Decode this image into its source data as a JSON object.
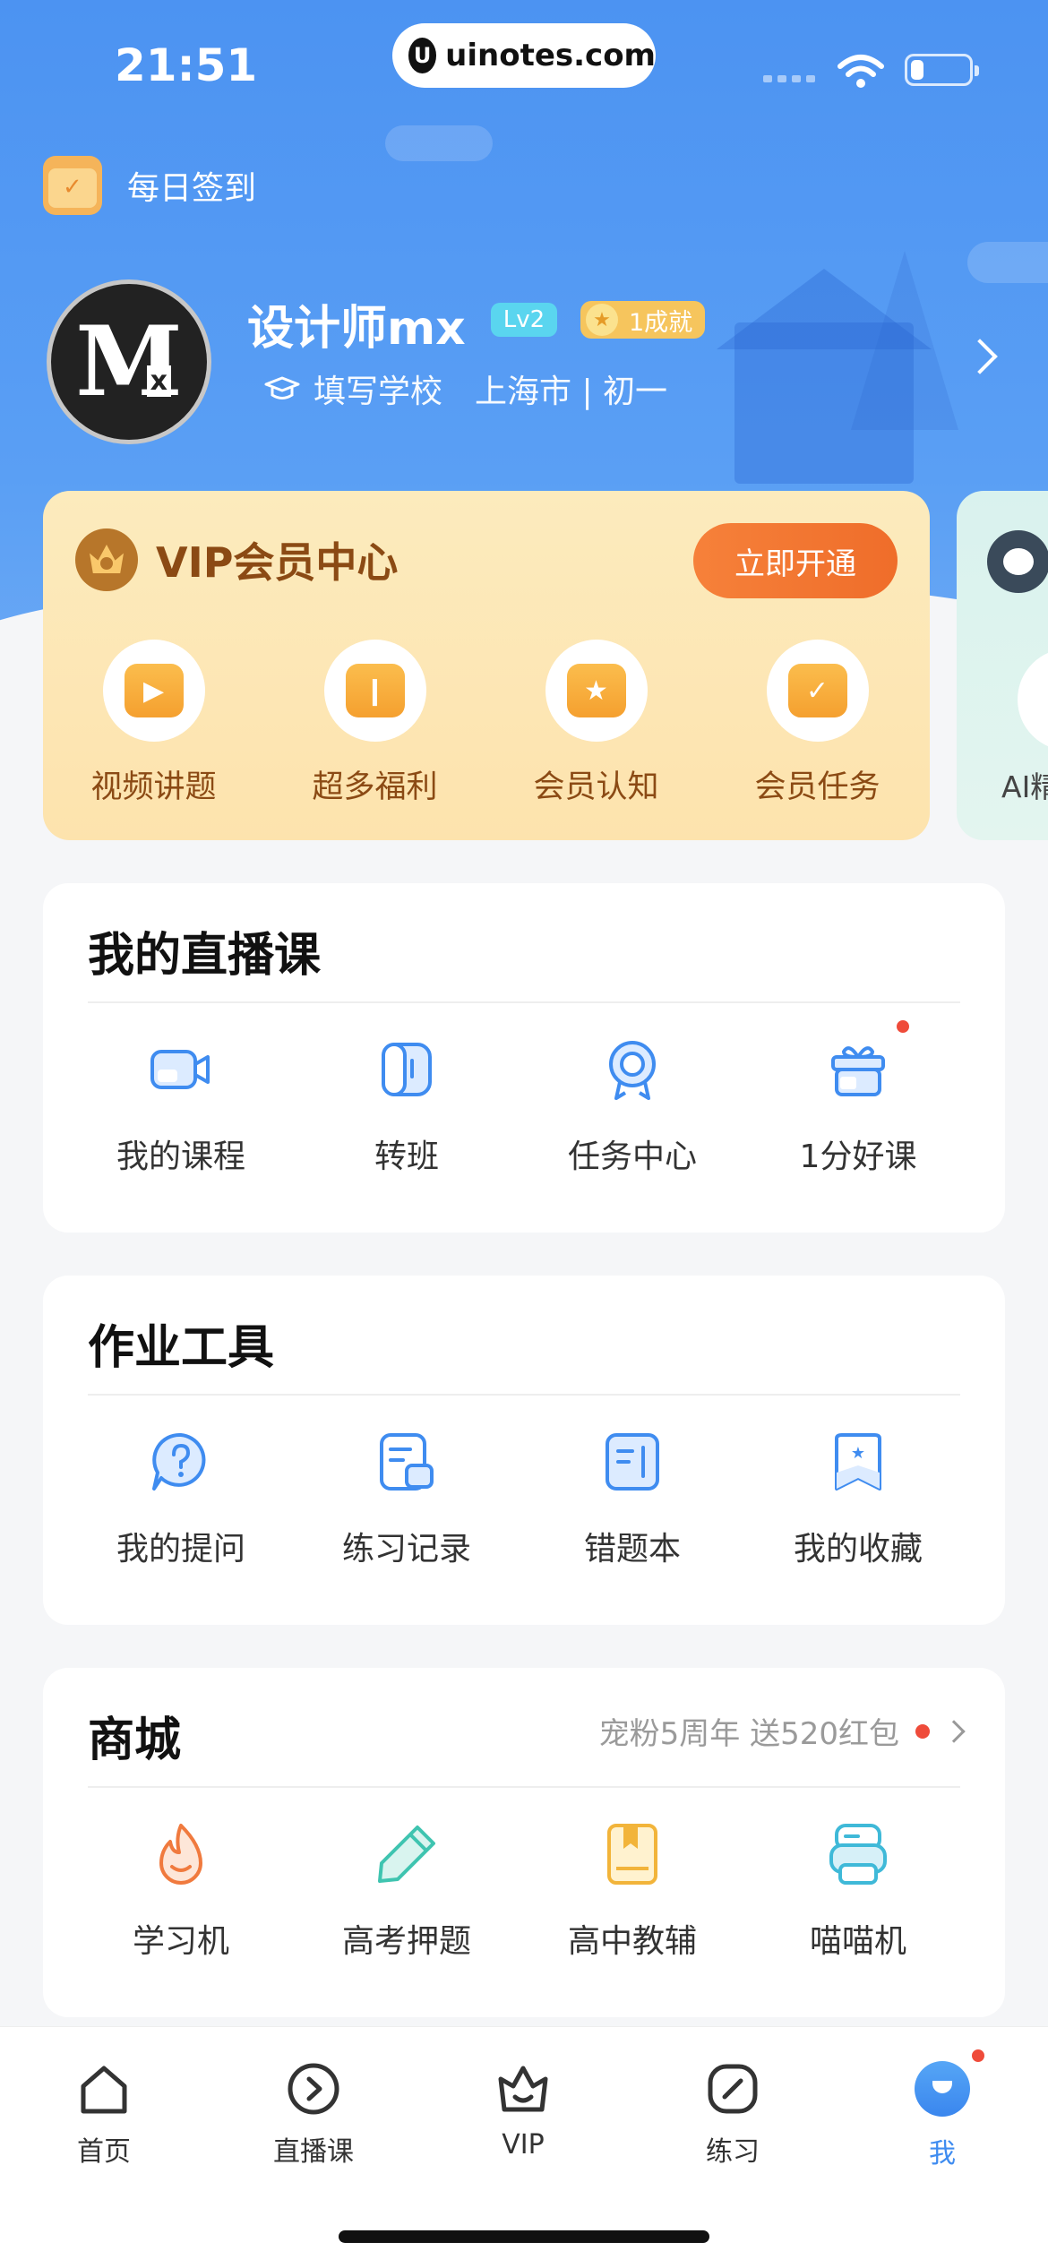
{
  "status_bar": {
    "time": "21:51",
    "url": "uinotes.com",
    "url_icon_letter": "U"
  },
  "checkin": {
    "label": "每日签到"
  },
  "profile": {
    "avatar_text": "M",
    "avatar_sub": "x",
    "name": "设计师mx",
    "level": "Lv2",
    "achievement": "1成就",
    "school": "填写学校",
    "location": "上海市 | 初一"
  },
  "vip": {
    "title": "VIP会员中心",
    "button": "立即开通",
    "items": [
      {
        "label": "视频讲题",
        "glyph": "▶"
      },
      {
        "label": "超多福利",
        "glyph": "❙"
      },
      {
        "label": "会员认知",
        "glyph": "★"
      },
      {
        "label": "会员任务",
        "glyph": "✓"
      }
    ]
  },
  "side_card": {
    "label": "AI精"
  },
  "live": {
    "title": "我的直播课",
    "items": [
      {
        "label": "我的课程",
        "icon": "video-camera-icon"
      },
      {
        "label": "转班",
        "icon": "transfer-icon"
      },
      {
        "label": "任务中心",
        "icon": "medal-icon"
      },
      {
        "label": "1分好课",
        "icon": "gift-icon"
      }
    ]
  },
  "homework": {
    "title": "作业工具",
    "items": [
      {
        "label": "我的提问",
        "icon": "question-bubble-icon"
      },
      {
        "label": "练习记录",
        "icon": "record-icon"
      },
      {
        "label": "错题本",
        "icon": "notebook-icon"
      },
      {
        "label": "我的收藏",
        "icon": "bookmark-icon"
      }
    ]
  },
  "mall": {
    "title": "商城",
    "promo": "宠粉5周年 送520红包",
    "items": [
      {
        "label": "学习机",
        "icon": "flame-icon"
      },
      {
        "label": "高考押题",
        "icon": "pencil-icon"
      },
      {
        "label": "高中教辅",
        "icon": "book-icon"
      },
      {
        "label": "喵喵机",
        "icon": "printer-icon"
      }
    ]
  },
  "tabs": [
    {
      "label": "首页",
      "icon": "home-icon"
    },
    {
      "label": "直播课",
      "icon": "play-circle-icon"
    },
    {
      "label": "VIP",
      "icon": "crown-icon"
    },
    {
      "label": "练习",
      "icon": "edit-icon"
    },
    {
      "label": "我",
      "icon": "profile-icon",
      "active": true
    }
  ],
  "colors": {
    "primary": "#3f8cf0",
    "vip_text": "#8b4a14",
    "vip_button": "#f6813a",
    "dot": "#ef4b3a"
  }
}
